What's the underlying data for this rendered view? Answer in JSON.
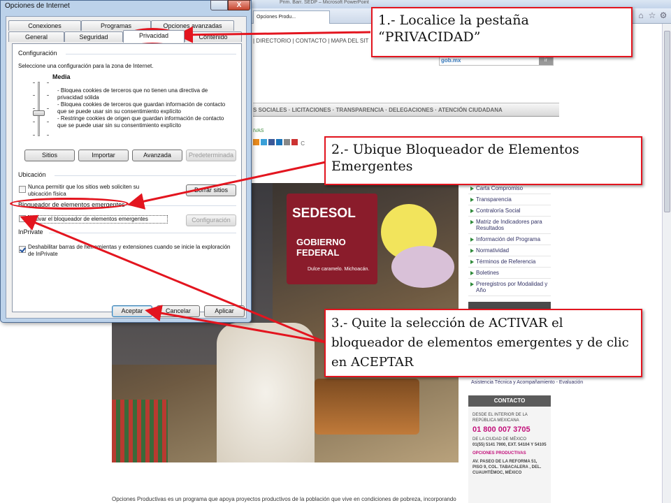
{
  "browser": {
    "window_title": "Prim. Barr. SEDP – Microsoft PowerPoint",
    "tab_label": "Opciones Produ...",
    "icon_home": "home-icon",
    "icon_favorites": "star-icon",
    "icon_settings": "gear-icon"
  },
  "site": {
    "nav_links": "| DIRECTORIO | CONTACTO | MAPA DEL SIT",
    "search_logo": "gob.mx",
    "search_button": "ir",
    "menu": "S SOCIALES  ·  LICITACIONES  ·  TRANSPARENCIA  ·  DELEGACIONES  ·  ATENCIÓN CIUDADANA",
    "breadcrumb": "IVAS",
    "share_label": "C",
    "photo_banner_title": "SEDESOL",
    "photo_banner_sub": "GOBIERNO FEDERAL",
    "photo_banner_caption": "Dulce caramelo. Michoacán.",
    "side_links": [
      "Carta Compromiso",
      "Transparencia",
      "Contraloría Social",
      "Matriz de Indicadores para Resultados",
      "Información del Programa",
      "Normatividad",
      "Términos de Referencia",
      "Boletines",
      "Preregistros por Modalidad y Año"
    ],
    "side_extra": "Asistencia Técnica y Acompañamiento - Evaluación",
    "contact_heading": "CONTACTO",
    "contact_line1": "DESDE EL INTERIOR DE LA REPÚBLICA MEXICANA",
    "contact_phone": "01 800 007 3705",
    "contact_line2": "DE LA CIUDAD DE MÉXICO",
    "contact_line3": "01(55) 5141 7900, EXT. 54104 Y 54105",
    "contact_line4": "OPCIONES PRODUCTIVAS",
    "contact_line5": "AV. PASEO DE LA REFORMA 51, PISO 9, COL. TABACALERA , DEL. CUAUHTÉMOC, MÉXICO",
    "footer": "Opciones Productivas es un programa que apoya proyectos productivos de la población que vive en condiciones de pobreza, incorporando"
  },
  "dialog": {
    "title": "Opciones de Internet",
    "close_glyph": "X",
    "tabs_row1": [
      "Conexiones",
      "Programas",
      "Opciones avanzadas"
    ],
    "tabs_row2": [
      "General",
      "Seguridad",
      "Privacidad",
      "Contenido"
    ],
    "config_group": "Configuración",
    "config_desc": "Seleccione una configuración para la zona de Internet.",
    "level": "Media",
    "level_bullets": [
      "- Bloquea cookies de terceros que no tienen una directiva de privacidad sólida",
      "- Bloquea cookies de terceros que guardan información de contacto que se puede usar sin su consentimiento explícito",
      "- Restringe cookies de origen que guardan información de contacto que se puede usar sin su consentimiento explícito"
    ],
    "btn_sitios": "Sitios",
    "btn_importar": "Importar",
    "btn_avanzada": "Avanzada",
    "btn_predeterminada": "Predeterminada",
    "location_group": "Ubicación",
    "location_check": "Nunca permitir que los sitios web soliciten su ubicación física",
    "btn_borrar_sitios": "Borrar sitios",
    "popup_group": "Bloqueador de elementos emergentes",
    "popup_check": "Activar el bloqueador de elementos emergentes",
    "btn_configuracion": "Configuración",
    "inprivate_group": "InPrivate",
    "inprivate_check": "Deshabilitar barras de herramientas y extensiones cuando se inicie la exploración de InPrivate",
    "btn_aceptar": "Aceptar",
    "btn_cancelar": "Cancelar",
    "btn_aplicar": "Aplicar",
    "location_checked": false,
    "popup_checked": false,
    "inprivate_checked": true
  },
  "annotations": {
    "step1": "1.- Localice la pestaña “PRIVACIDAD”",
    "step2": "2.- Ubique Bloqueador de Elementos Emergentes",
    "step3": "3.- Quite la selección de ACTIVAR el bloqueador de elementos emergentes y de clic en ACEPTAR",
    "color": "#e3151f"
  }
}
